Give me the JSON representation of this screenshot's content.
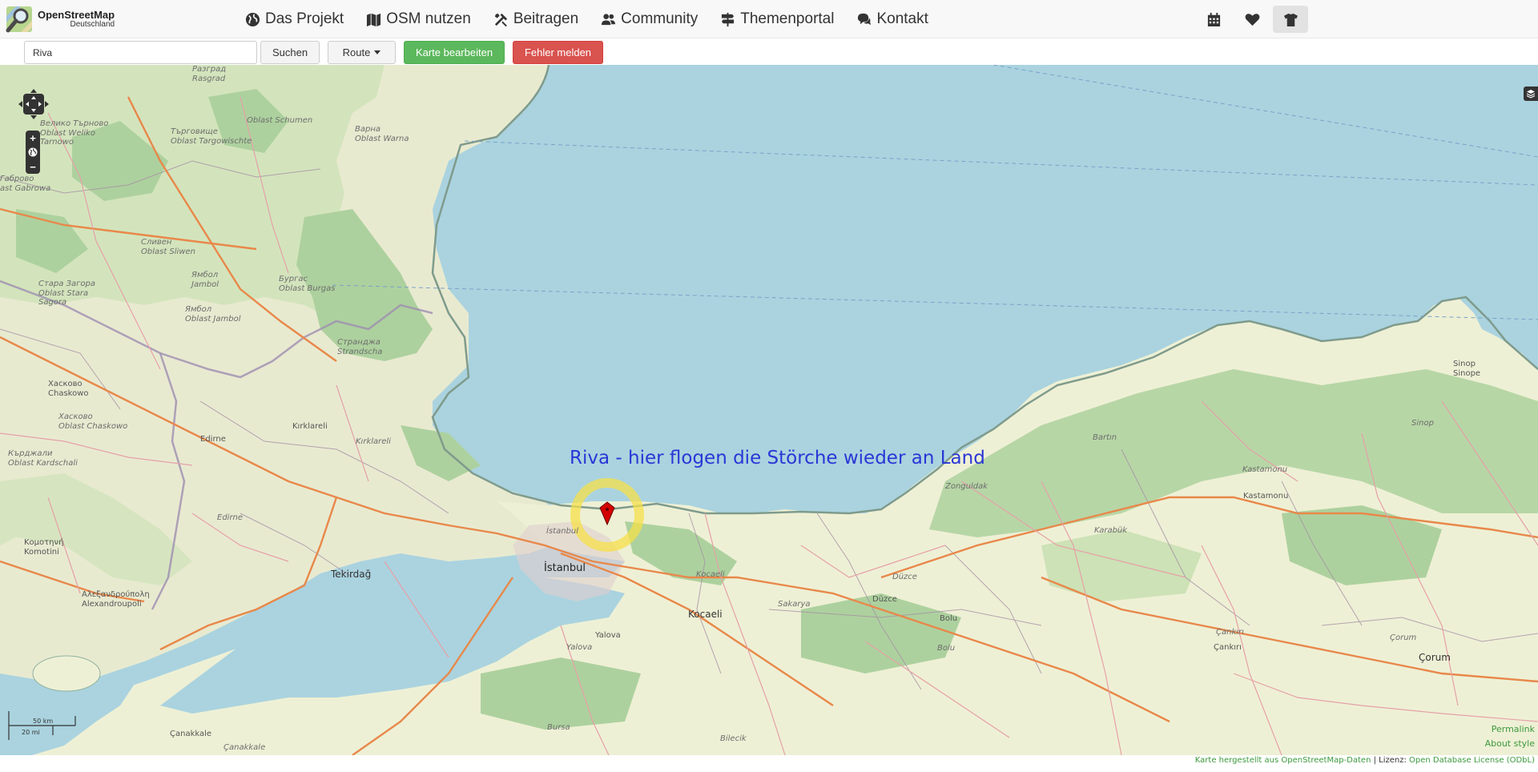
{
  "navbar": {
    "logo_title": "OpenStreetMap",
    "logo_subtitle": "Deutschland",
    "items": [
      {
        "label": "Das Projekt",
        "icon": "globe-icon"
      },
      {
        "label": "OSM nutzen",
        "icon": "map-icon"
      },
      {
        "label": "Beitragen",
        "icon": "tools-icon"
      },
      {
        "label": "Community",
        "icon": "users-icon"
      },
      {
        "label": "Themenportal",
        "icon": "signpost-icon"
      },
      {
        "label": "Kontakt",
        "icon": "comments-icon"
      }
    ],
    "right_icons": [
      "calendar-icon",
      "heart-icon",
      "tshirt-icon"
    ]
  },
  "toolbar": {
    "search_value": "Riva",
    "search_label": "Suchen",
    "route_label": "Route",
    "edit_label": "Karte bearbeiten",
    "report_label": "Fehler melden"
  },
  "map": {
    "annotation": "Riva - hier flogen die Störche wieder an Land",
    "marker_color": "#d40000",
    "highlight_color": "#f5e04a",
    "scale_km": "50 km",
    "scale_mi": "20 mi",
    "permalink": "Permalink",
    "about_style": "About style",
    "labels": {
      "razgrad": "Разград\nRasgrad",
      "targovishte": "Търговище\nOblast Targowischte",
      "veliko": "Велико Търново\nOblast Weliko\nTarnowo",
      "shumen": "Oblast Schumen",
      "varna": "Варна\nOblast Warna",
      "gabrovo": "Габрово\nast Gabrowa",
      "sliven": "Сливен\nOblast Sliwen",
      "yambol": "Ямбол\nJambol",
      "burgas": "Бургас\nOblast Burgas",
      "stara_zagora": "Стара Загора\nOblast Stara\nSagora",
      "yambol_oblast": "Ямбол\nOblast Jambol",
      "strandzha": "Странджа\nStrandscha",
      "haskovo_city": "Хасково\nChaskowo",
      "haskovo_oblast": "Хасково\nOblast Chaskowo",
      "kardzhali": "Кърджали\nOblast Kardschali",
      "edirne_city": "Edirne",
      "kirklareli_city": "Kırklareli",
      "kirklareli": "Kırklareli",
      "edirne": "Edirne",
      "komotini": "Κομοτηνή\nKomotini",
      "tekirdag": "Tekirdağ",
      "alexandroupoli": "Αλεξανδρούπολη\nAlexandroupoli",
      "istanbul_small": "İstanbul",
      "istanbul": "İstanbul",
      "yalova": "Yalova",
      "yalova_it": "Yalova",
      "kocaeli_it": "Kocaeli",
      "kocaeli": "Kocaeli",
      "sakarya": "Sakarya",
      "duzce_it": "Düzce",
      "duzce": "Düzce",
      "bolu": "Bolu",
      "bolu_it": "Bolu",
      "zonguldak": "Zonguldak",
      "bartin": "Bartın",
      "karabuk": "Karabük",
      "kastamonu_it": "Kastamonu",
      "kastamonu": "Kastamonu",
      "sinop_city": "Sinop\nSinope",
      "sinop": "Sinop",
      "cankiri_it": "Çankırı",
      "cankiri": "Çankırı",
      "corum_it": "Çorum",
      "corum": "Çorum",
      "bursa": "Bursa",
      "bilecik": "Bilecik",
      "canakkale": "Çanakkale",
      "canakkale_it": "Çanakkale"
    }
  },
  "footer": {
    "credit_link": "Karte hergestellt aus OpenStreetMap-Daten",
    "separator": " | Lizenz: ",
    "license_link": "Open Database License (ODbL)"
  }
}
